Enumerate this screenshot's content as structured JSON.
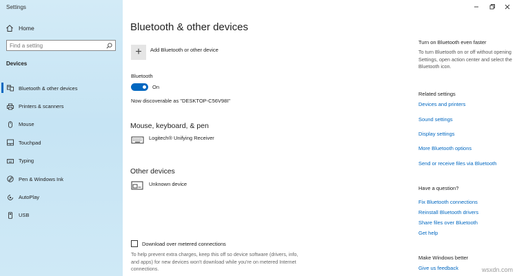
{
  "window": {
    "title": "Settings"
  },
  "sidebar": {
    "home_label": "Home",
    "search_placeholder": "Find a setting",
    "section_label": "Devices",
    "items": [
      {
        "label": "Bluetooth & other devices",
        "icon": "bluetooth-devices-icon",
        "active": true
      },
      {
        "label": "Printers & scanners",
        "icon": "printer-icon"
      },
      {
        "label": "Mouse",
        "icon": "mouse-icon"
      },
      {
        "label": "Touchpad",
        "icon": "touchpad-icon"
      },
      {
        "label": "Typing",
        "icon": "keyboard-icon"
      },
      {
        "label": "Pen & Windows Ink",
        "icon": "pen-icon"
      },
      {
        "label": "AutoPlay",
        "icon": "autoplay-icon"
      },
      {
        "label": "USB",
        "icon": "usb-icon"
      }
    ]
  },
  "main": {
    "title": "Bluetooth & other devices",
    "add_device_label": "Add Bluetooth or other device",
    "bluetooth_label": "Bluetooth",
    "toggle_state": "On",
    "bluetooth_on": true,
    "discoverable_text": "Now discoverable as \"DESKTOP-C56V98I\"",
    "mouse_section": "Mouse, keyboard, & pen",
    "mouse_device": "Logitech® Unifying Receiver",
    "other_section": "Other devices",
    "other_device": "Unknown device",
    "metered_label": "Download over metered connections",
    "metered_checked": false,
    "metered_help": "To help prevent extra charges, keep this off so device software (drivers, info, and apps) for new devices won't download while you're on metered Internet connections."
  },
  "right_pane": {
    "faster_heading": "Turn on Bluetooth even faster",
    "faster_text": "To turn Bluetooth on or off without opening Settings, open action center and select the Bluetooth icon.",
    "related_heading": "Related settings",
    "related_links": [
      "Devices and printers",
      "Sound settings",
      "Display settings",
      "More Bluetooth options",
      "Send or receive files via Bluetooth"
    ],
    "question_heading": "Have a question?",
    "question_links": [
      "Fix Bluetooth connections",
      "Reinstall Bluetooth drivers",
      "Share files over Bluetooth",
      "Get help"
    ],
    "better_heading": "Make Windows better",
    "better_link": "Give us feedback"
  },
  "watermark": "wsxdn.com",
  "colors": {
    "accent": "#0067c0",
    "sidebar_bg": "#cce8f5"
  }
}
